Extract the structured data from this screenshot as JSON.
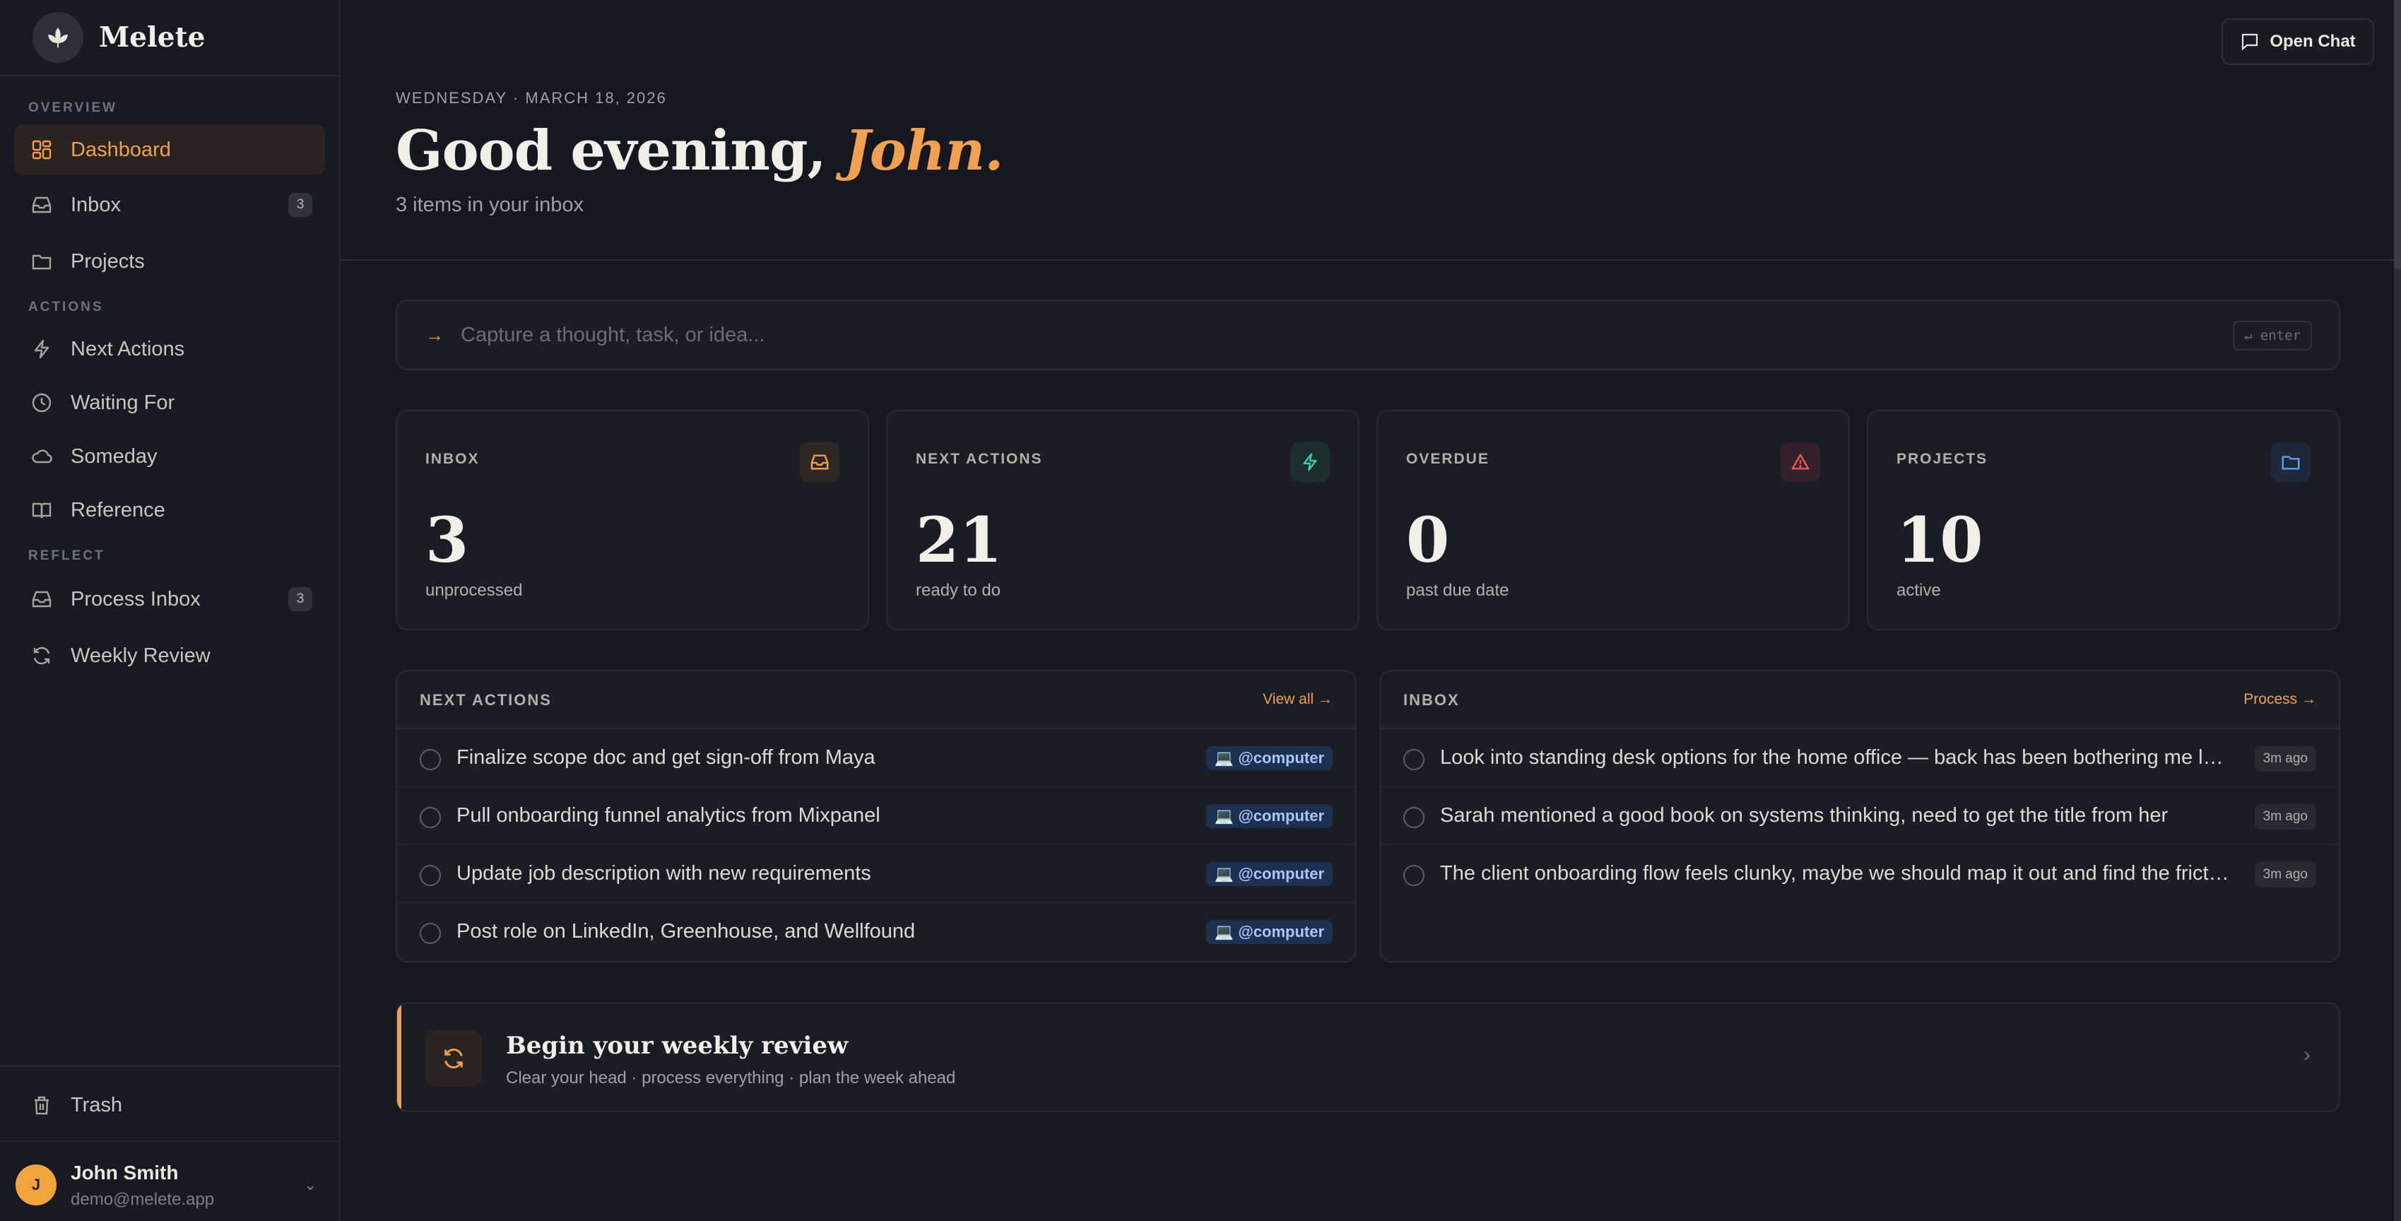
{
  "app": {
    "name": "Melete"
  },
  "sidebar": {
    "sections": {
      "overview": "OVERVIEW",
      "actions": "ACTIONS",
      "reflect": "REFLECT"
    },
    "items": [
      {
        "label": "Dashboard",
        "icon": "dashboard-icon",
        "active": true
      },
      {
        "label": "Inbox",
        "icon": "inbox-icon",
        "badge": "3"
      },
      {
        "label": "Projects",
        "icon": "folder-icon"
      },
      {
        "label": "Next Actions",
        "icon": "bolt-icon"
      },
      {
        "label": "Waiting For",
        "icon": "clock-icon"
      },
      {
        "label": "Someday",
        "icon": "cloud-icon"
      },
      {
        "label": "Reference",
        "icon": "book-icon"
      },
      {
        "label": "Process Inbox",
        "icon": "inbox-icon",
        "badge": "3"
      },
      {
        "label": "Weekly Review",
        "icon": "refresh-icon"
      }
    ],
    "trash": "Trash",
    "user": {
      "initial": "J",
      "name": "John Smith",
      "email": "demo@melete.app"
    }
  },
  "header": {
    "open_chat": "Open Chat",
    "date": "WEDNESDAY · MARCH 18, 2026",
    "greeting": "Good evening,",
    "name": "John.",
    "subtext": "3 items in your inbox"
  },
  "capture": {
    "arrow": "→",
    "placeholder": "Capture a thought, task, or idea...",
    "hint": "↵ enter"
  },
  "stats": [
    {
      "label": "INBOX",
      "value": "3",
      "sub": "unprocessed",
      "icon": "inbox-icon",
      "color": "#f0a050"
    },
    {
      "label": "NEXT ACTIONS",
      "value": "21",
      "sub": "ready to do",
      "icon": "bolt-icon",
      "color": "#3ec7b0"
    },
    {
      "label": "OVERDUE",
      "value": "0",
      "sub": "past due date",
      "icon": "alert-icon",
      "color": "#e85a5a"
    },
    {
      "label": "PROJECTS",
      "value": "10",
      "sub": "active",
      "icon": "folder-icon",
      "color": "#5aa0e8"
    }
  ],
  "next_actions": {
    "title": "NEXT ACTIONS",
    "link": "View all →",
    "items": [
      {
        "text": "Finalize scope doc and get sign-off from Maya",
        "tag": "@computer"
      },
      {
        "text": "Pull onboarding funnel analytics from Mixpanel",
        "tag": "@computer"
      },
      {
        "text": "Update job description with new requirements",
        "tag": "@computer"
      },
      {
        "text": "Post role on LinkedIn, Greenhouse, and Wellfound",
        "tag": "@computer"
      }
    ]
  },
  "inbox": {
    "title": "INBOX",
    "link": "Process →",
    "items": [
      {
        "text": "Look into standing desk options for the home office — back has been bothering me lately",
        "time": "3m ago"
      },
      {
        "text": "Sarah mentioned a good book on systems thinking, need to get the title from her",
        "time": "3m ago"
      },
      {
        "text": "The client onboarding flow feels clunky, maybe we should map it out and find the friction p...",
        "time": "3m ago"
      }
    ]
  },
  "review": {
    "title": "Begin your weekly review",
    "sub": "Clear your head · process everything · plan the week ahead",
    "chevron": "›"
  },
  "colors": {
    "accent": "#f0a050",
    "background": "#151820",
    "sidebar": "#171a22"
  }
}
